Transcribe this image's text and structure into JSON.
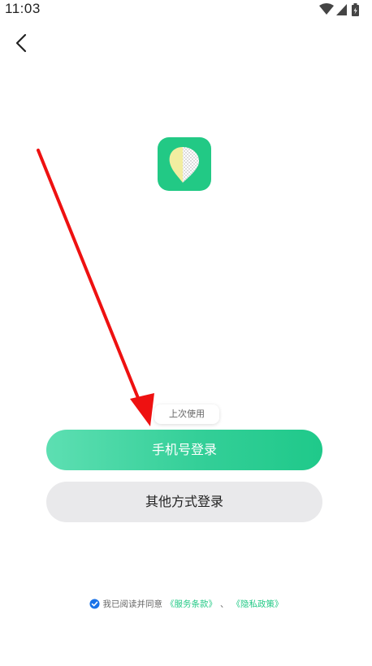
{
  "status_bar": {
    "time": "11:03",
    "icons": [
      "wifi-icon",
      "cellular-signal-icon",
      "battery-charging-icon"
    ]
  },
  "nav": {
    "back_icon": "chevron-left-icon"
  },
  "logo": {
    "icon": "app-logo-icon",
    "background_color": "#22c985",
    "leaf_color": "#f2eda0"
  },
  "login": {
    "last_used_tip": "上次使用",
    "phone_button_label": "手机号登录",
    "other_button_label": "其他方式登录",
    "accent_color": "#22c985"
  },
  "agreement": {
    "checked": true,
    "prefix": "我已阅读并同意",
    "terms_link": "《服务条款》",
    "separator": "、",
    "privacy_link": "《隐私政策》"
  },
  "annotation": {
    "icon": "red-arrow-icon",
    "color": "#ee1111"
  }
}
